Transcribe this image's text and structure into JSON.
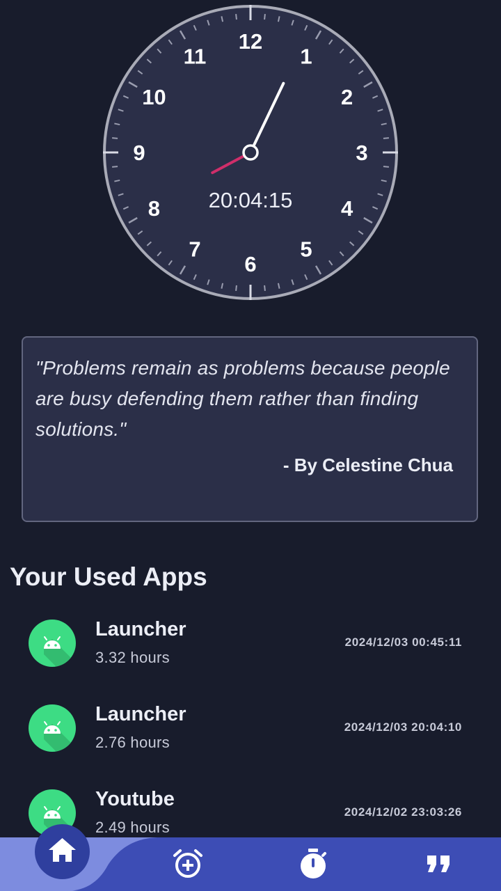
{
  "clock": {
    "numerals": [
      "12",
      "1",
      "2",
      "3",
      "4",
      "5",
      "6",
      "7",
      "8",
      "9",
      "10",
      "11"
    ],
    "digital_time": "20:04:15",
    "hands": {
      "hour": 8,
      "minute": 4,
      "second": 15
    },
    "colors": {
      "face": "#2b2f48",
      "rim": "#a9abb7",
      "minute_hand": "#ffffff",
      "hour_hand": "#d02e6a"
    }
  },
  "quote": {
    "text": "\"Problems remain as problems because people are busy defending them rather than finding solutions.\"",
    "author": "- By Celestine Chua"
  },
  "apps_section": {
    "title": "Your Used Apps",
    "items": [
      {
        "name": "Launcher",
        "usage": "3.32 hours",
        "last_used": "2024/12/03 00:45:11",
        "icon": "android-icon"
      },
      {
        "name": "Launcher",
        "usage": "2.76 hours",
        "last_used": "2024/12/03 20:04:10",
        "icon": "android-icon"
      },
      {
        "name": "Youtube",
        "usage": "2.49 hours",
        "last_used": "2024/12/02 23:03:26",
        "icon": "android-icon"
      }
    ]
  },
  "nav": {
    "items": [
      {
        "icon": "home-icon",
        "active": true
      },
      {
        "icon": "add-alarm-icon",
        "active": false
      },
      {
        "icon": "stopwatch-icon",
        "active": false
      },
      {
        "icon": "quote-icon",
        "active": false
      }
    ],
    "colors": {
      "bar": "#3d4db5",
      "active_bg": "#7d8cdf",
      "active_circle": "#2f3f9e"
    }
  }
}
